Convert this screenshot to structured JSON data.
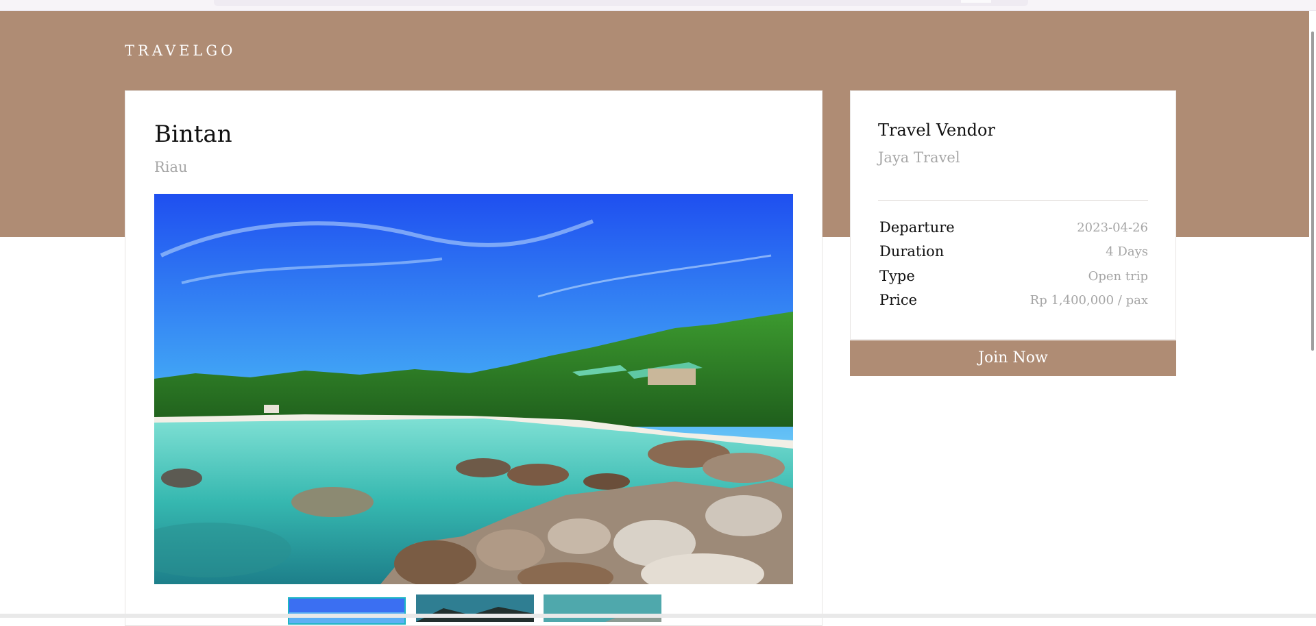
{
  "brand": {
    "name": "TRAVELGO"
  },
  "trip": {
    "title": "Bintan",
    "region": "Riau"
  },
  "vendor": {
    "heading": "Travel Vendor",
    "name": "Jaya Travel"
  },
  "details": [
    {
      "label": "Departure",
      "value": "2023-04-26"
    },
    {
      "label": "Duration",
      "value": "4 Days"
    },
    {
      "label": "Type",
      "value": "Open trip"
    },
    {
      "label": "Price",
      "value": "Rp 1,400,000 / pax"
    }
  ],
  "actions": {
    "join_label": "Join Now"
  },
  "colors": {
    "brand_brown": "#af8c74",
    "thumb_active_border": "#1fb7c4"
  }
}
